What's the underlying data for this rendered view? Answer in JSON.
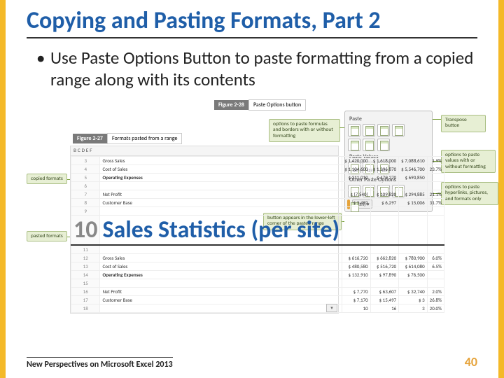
{
  "title": "Copying and Pasting Formats, Part 2",
  "bullet": "Use Paste Options Button to paste formatting from a copied range along with its contents",
  "fig_right": {
    "num": "Figure 2-28",
    "caption": "Paste Options button"
  },
  "fig_left": {
    "num": "Figure 2-27",
    "caption": "Formats pasted from a range"
  },
  "panel": {
    "h_paste": "Paste",
    "h_values": "Paste Values",
    "h_other": "Other Paste Options",
    "ctrl": "(Ctrl) ▾"
  },
  "callouts": {
    "c1": "options to paste formulas and borders with or without formatting",
    "c2": "Transpose button",
    "c3": "options to paste values with or without formatting",
    "c4": "options to paste hyperlinks, pictures, and formats only",
    "c5": "button appears in the lower-left corner of the pasted range",
    "lc1": "copied formats",
    "lc2": "pasted formats"
  },
  "ws": {
    "header": "B        C        D        E        F",
    "rows": [
      {
        "n": "3",
        "a": "Gross Sales",
        "c": "$ 1,420,000",
        "d": "$ 1,618,000",
        "e": "$ 7,088,610",
        "f": "1.9%"
      },
      {
        "n": "4",
        "a": "Cost of Sales",
        "c": "$ 1,104,600",
        "d": "$ 1,296,870",
        "e": "$ 5,546,700",
        "f": "23.7%"
      },
      {
        "n": "5",
        "a": "Operating Expenses",
        "c": "$ 311,010",
        "d": "$ 479,270",
        "e": "$ 690,850",
        "f": "",
        "b": true
      },
      {
        "n": "6",
        "a": "",
        "c": "",
        "d": "",
        "e": "",
        "f": ""
      },
      {
        "n": "7",
        "a": "Net Profit",
        "c": "$ (7,540)",
        "d": "$ 109,820",
        "e": "$ 294,885",
        "f": "21.1%"
      },
      {
        "n": "8",
        "a": "Customer Base",
        "c": "$ 3,492",
        "d": "$ 6,297",
        "e": "$ 15,006",
        "f": "31.7%"
      },
      {
        "n": "9",
        "a": "",
        "c": "",
        "d": "",
        "e": "",
        "f": ""
      },
      {
        "sec": true,
        "n": "10",
        "a": "Sales Statistics (per site)",
        "c": "",
        "d": "",
        "e": "",
        "f": "",
        "title": true
      },
      {
        "n": "11",
        "a": "",
        "c": "",
        "d": "",
        "e": "",
        "f": ""
      },
      {
        "n": "12",
        "a": "Gross Sales",
        "c": "$ 616,720",
        "d": "$ 662,820",
        "e": "$ 780,900",
        "f": "6.0%"
      },
      {
        "n": "13",
        "a": "Cost of Sales",
        "c": "$ 480,580",
        "d": "$ 516,720",
        "e": "$ 614,080",
        "f": "6.5%"
      },
      {
        "n": "14",
        "a": "Operating Expenses",
        "c": "$ 132,910",
        "d": "$ 97,890",
        "e": "$ 76,500",
        "f": "",
        "b": true
      },
      {
        "n": "15",
        "a": "",
        "c": "",
        "d": "",
        "e": "",
        "f": ""
      },
      {
        "n": "16",
        "a": "Net Profit",
        "c": "$ 7,770",
        "d": "$ 63,607",
        "e": "$ 32,740",
        "f": "2.0%"
      },
      {
        "n": "17",
        "a": "Customer Base",
        "c": "$ 7,170",
        "d": "$ 15,497",
        "e": "$ 3",
        "f": "26.8%"
      },
      {
        "n": "18",
        "a": "",
        "c": "10",
        "d": "16",
        "e": "3",
        "f": "20.0%"
      }
    ]
  },
  "footer": {
    "src": "New Perspectives on Microsoft Excel 2013",
    "page": "40"
  }
}
